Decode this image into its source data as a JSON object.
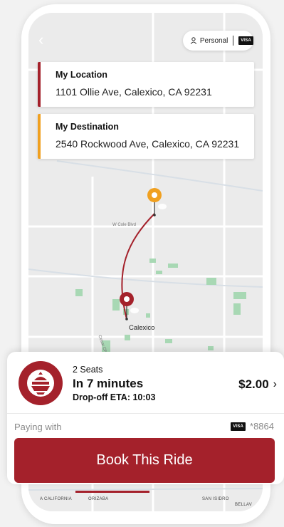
{
  "header": {
    "profile_label": "Personal",
    "card_brand": "VISA"
  },
  "route": {
    "origin": {
      "title": "My Location",
      "address": "1101 Ollie Ave, Calexico, CA 92231",
      "color": "#a4212b"
    },
    "destination": {
      "title": "My Destination",
      "address": "2540 Rockwood Ave, Calexico, CA 92231",
      "color": "#f0a020"
    }
  },
  "map": {
    "city_label": "Calexico",
    "street_labels": [
      "W Cole Blvd",
      "Cesar Chavez"
    ],
    "bottom_labels": [
      "A CALIFORNIA",
      "ORIZABA",
      "SAN ISIDRO",
      "BELLAV"
    ]
  },
  "ride": {
    "seats": "2 Seats",
    "eta": "In 7 minutes",
    "dropoff_eta": "Drop-off ETA: 10:03",
    "price": "$2.00",
    "paying_with_label": "Paying with",
    "card_brand": "VISA",
    "card_last4": "*8864"
  },
  "actions": {
    "book_label": "Book This Ride"
  },
  "colors": {
    "brand": "#a4212b",
    "destination": "#f0a020",
    "park_green": "#a8d8b4"
  }
}
